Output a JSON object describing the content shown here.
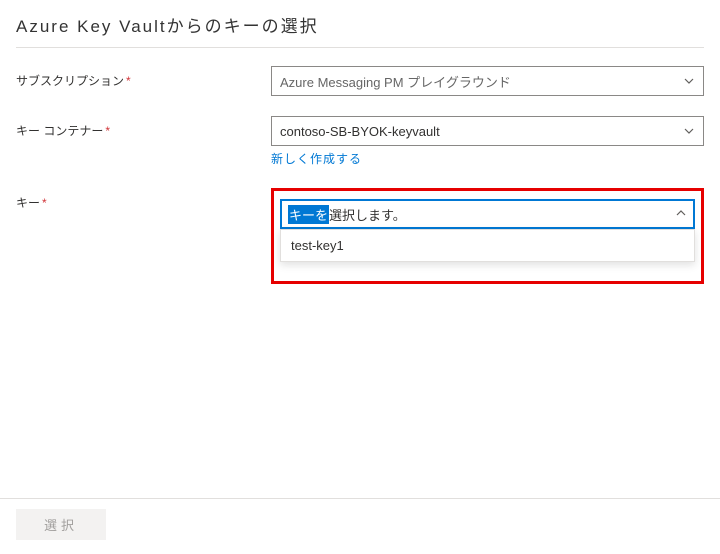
{
  "title": "Azure Key Vaultからのキーの選択",
  "labels": {
    "subscription": "サブスクリプション",
    "keyContainer": "キー コンテナー",
    "key": "キー"
  },
  "subscription": {
    "selected": "Azure Messaging PM プレイグラウンド"
  },
  "keyContainer": {
    "selected": "contoso-SB-BYOK-keyvault",
    "createNew": "新しく作成する"
  },
  "key": {
    "placeholder_sel": "キーを",
    "placeholder_rest": "選択します。",
    "options": [
      "test-key1"
    ]
  },
  "footer": {
    "selectButton": "選択"
  }
}
